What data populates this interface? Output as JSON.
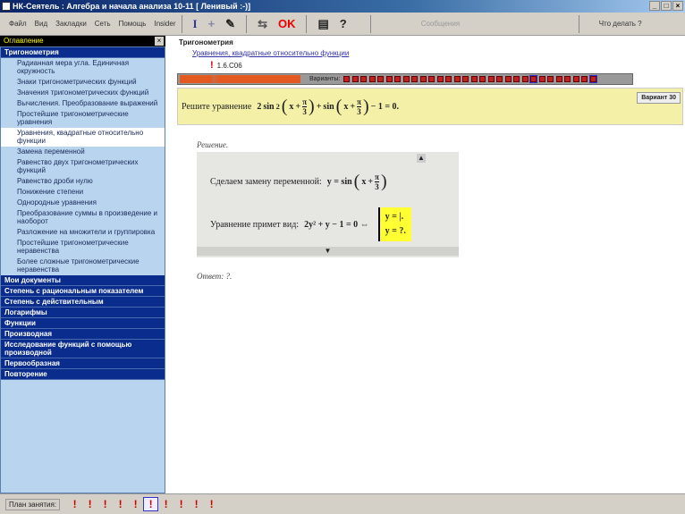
{
  "window": {
    "title": "НК-Сеятель : Алгебра и начала анализа 10-11 [ Ленивый :-)]",
    "controls": [
      "_",
      "□",
      "×"
    ]
  },
  "menu": [
    "Файл",
    "Вид",
    "Закладки",
    "Сеть",
    "Помощь",
    "Insider"
  ],
  "toolbar": {
    "i": "I",
    "plus": "+",
    "ok": "OK",
    "help": "?",
    "messages": "Сообщения",
    "todo": "Что делать ?"
  },
  "sidebar": {
    "title": "Оглавление",
    "close": "×",
    "current_section": "Тригонометрия",
    "items": [
      "Радианная мера угла. Единичная окружность",
      "Знаки тригонометрических функций",
      "Значения тригонометрических функций",
      "Вычисления. Преобразование выражений",
      "Простейшие тригонометрические уравнения",
      "Уравнения, квадратные относительно функции",
      "Замена переменной",
      "Равенство двух тригонометрических функций",
      "Равенство дроби нулю",
      "Понижение степени",
      "Однородные уравнения",
      "Преобразование суммы в произведение и наоборот",
      "Разложение на множители и группировка",
      "Простейшие тригонометрические неравенства",
      "Более сложные тригонометрические неравенства"
    ],
    "selected_index": 5,
    "sections": [
      "Мои документы",
      "Степень с рациональным показателем",
      "Степень с действительным",
      "Логарифмы",
      "Функции",
      "Производная",
      "Исследование функций с помощью производной",
      "Первообразная",
      "Повторение"
    ]
  },
  "breadcrumb": {
    "root": "Тригонометрия",
    "topic": "Уравнения, квадратные относительно функции",
    "task": "1.6.С06"
  },
  "variants": {
    "label": "Варианты:",
    "count": 30,
    "current": 30,
    "progress": 0.27,
    "badge": "Вариант 30"
  },
  "task": {
    "prompt": "Решите уравнение",
    "eq": {
      "coef": "2",
      "fn": "sin",
      "pow": "2",
      "x": "x",
      "plus": "+",
      "num": "π",
      "den": "3",
      "tail": "− 1 = 0."
    }
  },
  "solution": {
    "title": "Решение.",
    "line1": "Сделаем замену переменной:",
    "line1_math": "y = sin",
    "line2": "Уравнение примет вид:",
    "line2_math": "2y² + y − 1 = 0 ⇔",
    "sys1": "y = |.",
    "sys2": "y = ?.",
    "up": "▲",
    "down": "▼"
  },
  "answer": "Ответ: ?.",
  "plan": {
    "label": "План занятия:",
    "count": 10,
    "current": 6
  }
}
